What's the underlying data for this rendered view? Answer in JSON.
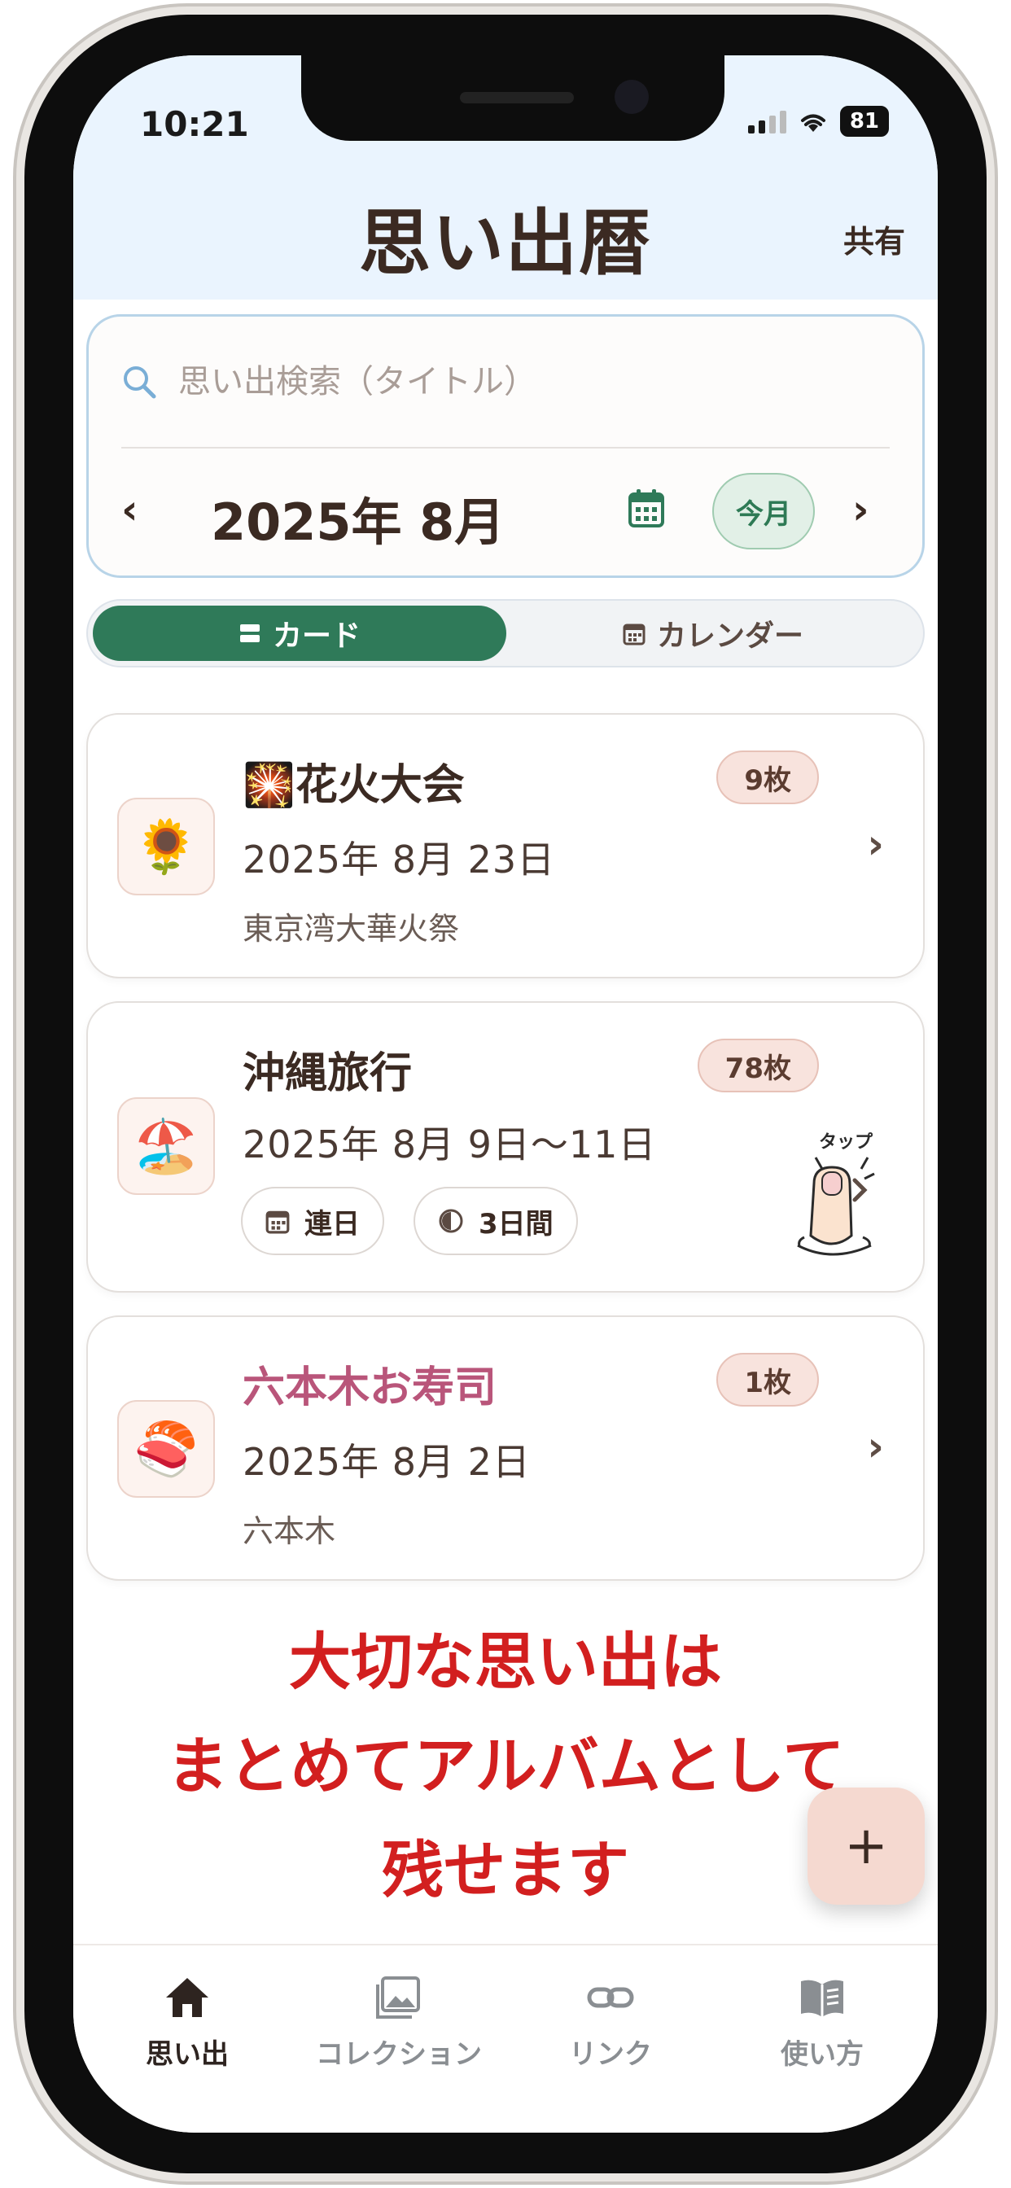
{
  "status_bar": {
    "time": "10:21",
    "battery": "81"
  },
  "header": {
    "title": "思い出暦",
    "share_label": "共有"
  },
  "search": {
    "placeholder": "思い出検索（タイトル）"
  },
  "month_nav": {
    "prev": "‹",
    "next": "›",
    "month_label": "2025年 8月",
    "today_label": "今月"
  },
  "view_toggle": {
    "card_label": "カード",
    "calendar_label": "カレンダー",
    "active": "card"
  },
  "memories": [
    {
      "emoji": "🌻",
      "title_emoji": "🎇",
      "title": "花火大会",
      "date": "2025年 8月 23日",
      "location": "東京湾大華火祭",
      "count": "9枚"
    },
    {
      "emoji": "🏖️",
      "title": "沖縄旅行",
      "date": "2025年 8月 9日〜11日",
      "count": "78枚",
      "chip_consecutive": "連日",
      "chip_duration": "3日間",
      "tap_label": "タップ"
    },
    {
      "emoji": "🍣",
      "title": "六本木お寿司",
      "date": "2025年 8月 2日",
      "location": "六本木",
      "count": "1枚"
    }
  ],
  "promo": {
    "line1": "大切な思い出は",
    "line2": "まとめてアルバムとして",
    "line3": "残せます"
  },
  "fab": {
    "label": "+"
  },
  "tabs": [
    {
      "label": "思い出",
      "icon": "home-icon",
      "active": true
    },
    {
      "label": "コレクション",
      "icon": "gallery-icon",
      "active": false
    },
    {
      "label": "リンク",
      "icon": "link-icon",
      "active": false
    },
    {
      "label": "使い方",
      "icon": "book-icon",
      "active": false
    }
  ],
  "colors": {
    "accent_green": "#2f7a59",
    "header_bg": "#eaf4fe",
    "promo_red": "#d21f1f",
    "title_pink": "#b9557a",
    "badge_bg": "#f8e3dd"
  }
}
